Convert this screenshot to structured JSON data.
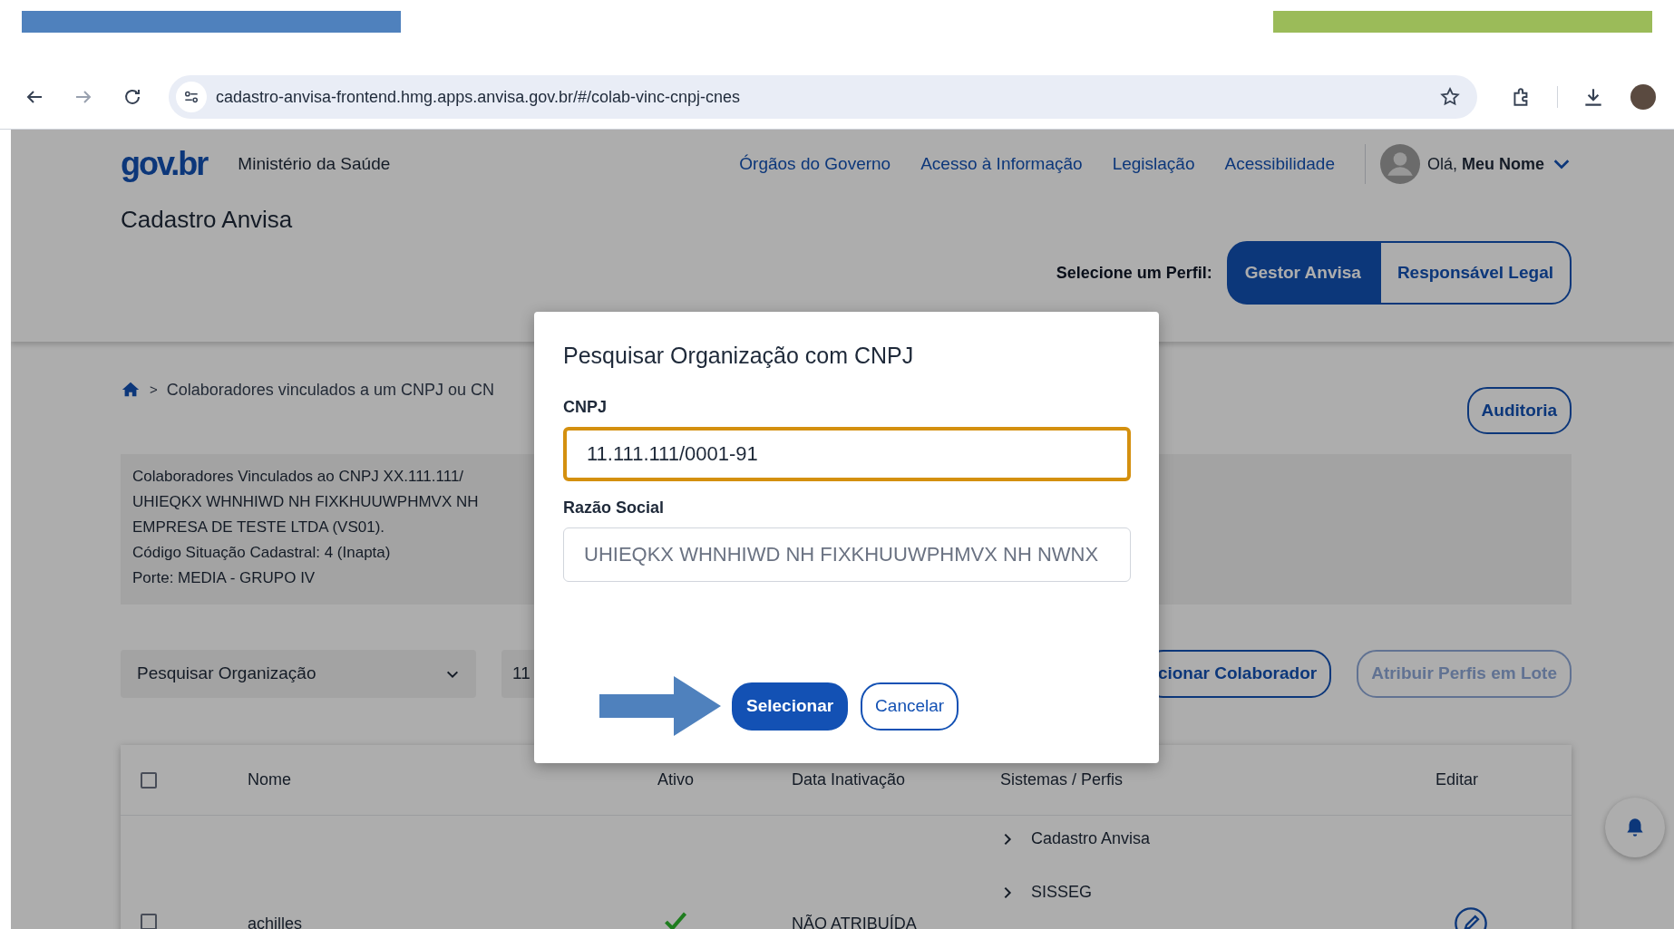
{
  "annotation_bars": [
    {
      "color": "#4f81bd"
    },
    {
      "color": "#9bbb59"
    }
  ],
  "browser": {
    "nav_buttons": [
      {
        "kind": "back",
        "disabled": false
      },
      {
        "kind": "forward",
        "disabled": true
      },
      {
        "kind": "reload",
        "disabled": false
      }
    ],
    "url": "cadastro-anvisa-frontend.hmg.apps.anvisa.gov.br/#/colab-vinc-cnpj-cnes"
  },
  "header": {
    "logo": "gov.br",
    "ministry": "Ministério da Saúde",
    "nav_links": [
      "Órgãos do Governo",
      "Acesso à Informação",
      "Legislação",
      "Acessibilidade"
    ],
    "greeting": "Olá, **Meu Nome**",
    "app_title": "Cadastro Anvisa",
    "profile_label": "Selecione um Perfil:",
    "profiles": [
      {
        "label": "Gestor Anvisa",
        "selected": true
      },
      {
        "label": "Responsável Legal",
        "selected": false
      }
    ]
  },
  "breadcrumb_separator": ">",
  "breadcrumb": "Colaboradores vinculados a um CNPJ ou CN",
  "audit_button": "Auditoria",
  "info_lines": [
    "Colaboradores Vinculados ao CNPJ XX.111.111/",
    "UHIEQKX WHNHIWD NH FIXKHUUWPHMVX NH",
    "EMPRESA DE TESTE LTDA (VS01).",
    "Código Situação Cadastral: 4 (Inapta)",
    "Porte: MEDIA - GRUPO IV"
  ],
  "search": {
    "select": "Pesquisar Organização",
    "value": "11"
  },
  "actions": [
    {
      "label": "cionar Colaborador",
      "disabled": false
    },
    {
      "label": "Atribuir Perfis em Lote",
      "disabled": true
    }
  ],
  "table": {
    "select_all_checked": false,
    "columns": [
      "Nome",
      "Ativo",
      "Data Inativação",
      "Sistemas / Perfis",
      "Editar"
    ],
    "rows": [
      {
        "checked": false,
        "name": "achilles",
        "active": true,
        "inactivation": "NÃO ATRIBUÍDA",
        "systems": [
          "Cadastro Anvisa",
          "SISSEG"
        ]
      }
    ]
  },
  "modal": {
    "title": "Pesquisar Organização com CNPJ",
    "fields": [
      {
        "label": "CNPJ",
        "value": "11.111.111/0001-91",
        "focused": true,
        "disabled": false
      },
      {
        "label": "Razão Social",
        "value": "UHIEQKX WHNHIWD NH FIXKHUUWPHMVX NH NWNX",
        "focused": false,
        "disabled": true
      }
    ],
    "buttons": [
      {
        "label": "Selecionar",
        "primary": true
      },
      {
        "label": "Cancelar",
        "primary": false
      }
    ]
  }
}
